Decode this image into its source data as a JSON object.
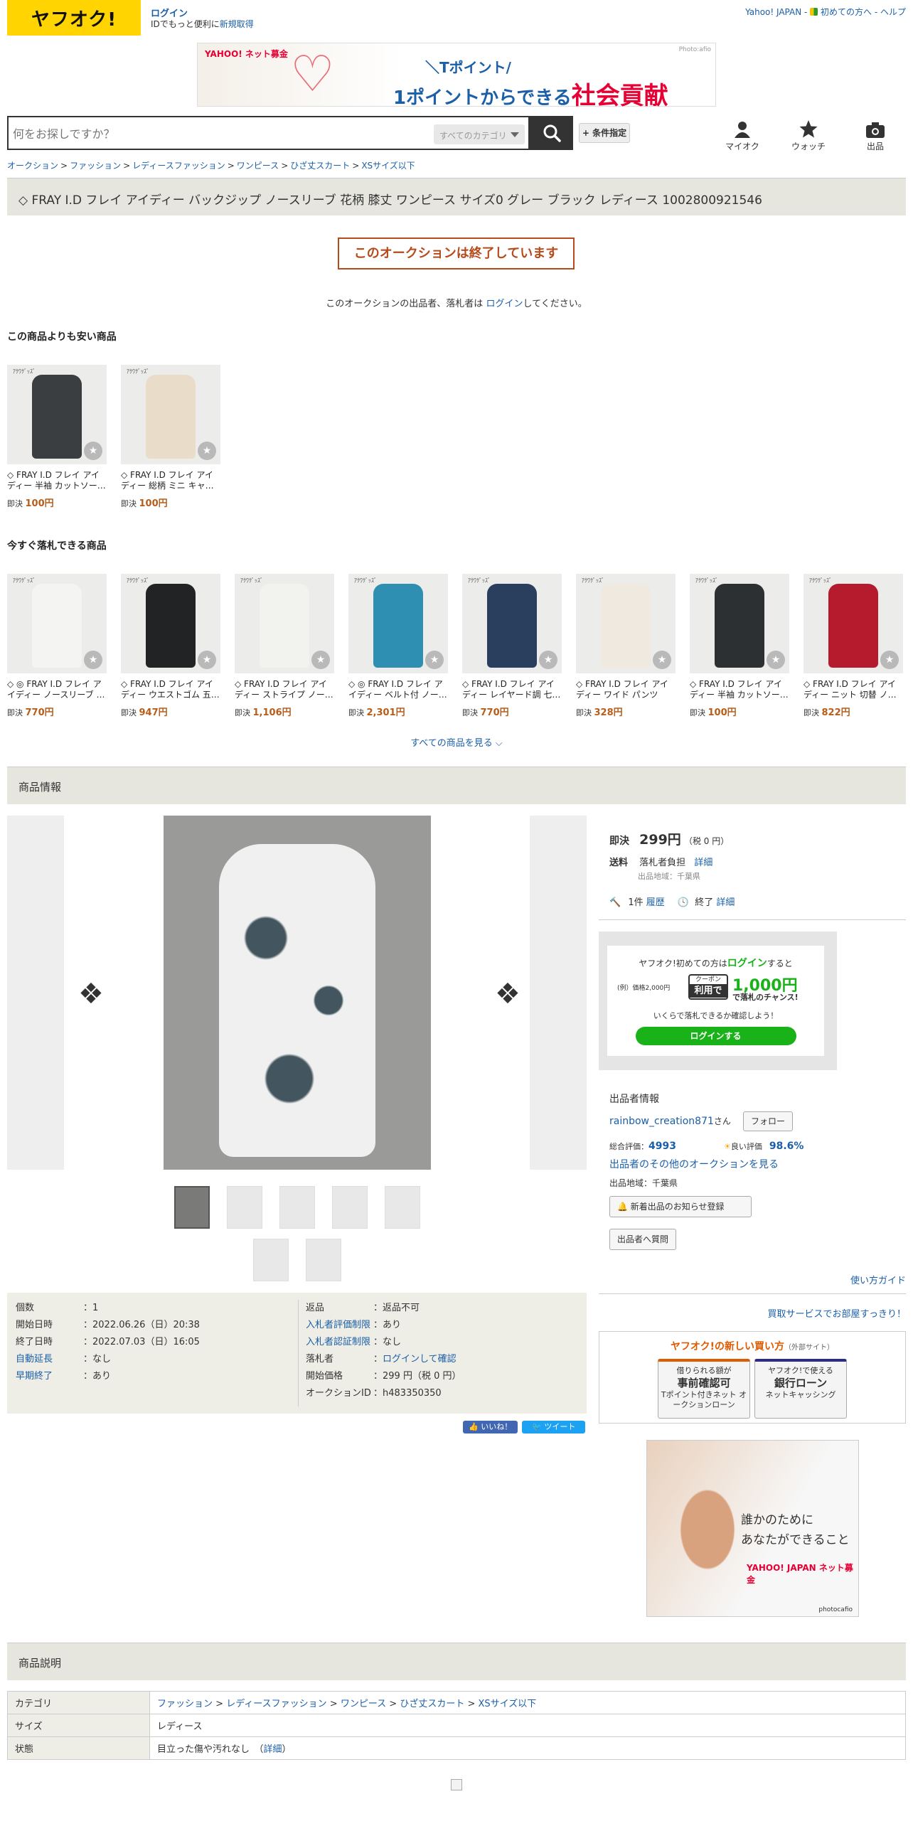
{
  "header": {
    "logo_text": "ヤフオク!",
    "login_label": "ログイン",
    "login_sub_prefix": "IDでもっと便利に",
    "login_sub_link": "新規取得",
    "top_links": [
      "Yahoo! JAPAN",
      "初めての方へ",
      "ヘルプ"
    ],
    "banner": {
      "brand": "YAHOO! ネット募金",
      "line1": "＼Tポイント/",
      "line2_a": "1ポイントからできる",
      "line2_b": "社会貢献",
      "credit": "Photo:afio"
    },
    "search": {
      "placeholder": "何をお探しですか？",
      "category": "すべてのカテゴリ",
      "condition_label": "+ 条件指定"
    },
    "icons": [
      {
        "label": "マイオク",
        "icon": "person-icon"
      },
      {
        "label": "ウォッチ",
        "icon": "star-icon"
      },
      {
        "label": "出品",
        "icon": "camera-icon"
      }
    ]
  },
  "breadcrumb": [
    "オークション",
    "ファッション",
    "レディースファッション",
    "ワンピース",
    "ひざ丈スカート",
    "XSサイズ以下"
  ],
  "title": "◇ FRAY I.D フレイ アイディー バックジップ ノースリーブ 花柄 膝丈 ワンピース サイズ0 グレー ブラック レディース 1002800921546",
  "ended": {
    "label": "このオークションは終了しています",
    "msg_prefix": "このオークションの出品者、落札者は",
    "msg_link": "ログイン",
    "msg_suffix": "してください。"
  },
  "cheaper": {
    "heading": "この商品よりも安い商品",
    "items": [
      {
        "name": "◇ FRAY I.D フレイ アイディー 半袖 カットソー…",
        "price_prefix": "即決",
        "price": "100円",
        "color": "#3a3e41"
      },
      {
        "name": "◇ FRAY I.D フレイ アイディー 総柄 ミニ キャ…",
        "price_prefix": "即決",
        "price": "100円",
        "color": "#e9dcc8"
      }
    ]
  },
  "instant": {
    "heading": "今すぐ落札できる商品",
    "items": [
      {
        "name": "◇ ◎ FRAY I.D フレイ アイディー ノースリーブ …",
        "price_prefix": "即決",
        "price": "770円",
        "color": "#f4f4f2"
      },
      {
        "name": "◇ FRAY I.D フレイ アイディー ウエストゴム 五…",
        "price_prefix": "即決",
        "price": "947円",
        "color": "#222324"
      },
      {
        "name": "◇ FRAY I.D フレイ アイディー ストライプ ノー…",
        "price_prefix": "即決",
        "price": "1,106円",
        "color": "#f2f2ef"
      },
      {
        "name": "◇ ◎ FRAY I.D フレイ アイディー ベルト付 ノー…",
        "price_prefix": "即決",
        "price": "2,301円",
        "color": "#2e8fb2"
      },
      {
        "name": "◇ FRAY I.D フレイ アイディー レイヤード調 七…",
        "price_prefix": "即決",
        "price": "770円",
        "color": "#2a3f5e"
      },
      {
        "name": "◇ FRAY I.D フレイ アイディー ワイド パンツ サ…",
        "price_prefix": "即決",
        "price": "328円",
        "color": "#efe9df"
      },
      {
        "name": "◇ FRAY I.D フレイ アイディー 半袖 カットソー…",
        "price_prefix": "即決",
        "price": "100円",
        "color": "#2c3033"
      },
      {
        "name": "◇ FRAY I.D フレイ アイディー ニット 切替 ノ…",
        "price_prefix": "即決",
        "price": "822円",
        "color": "#b51b2c"
      }
    ],
    "see_all": "すべての商品を見る"
  },
  "product_info": {
    "heading": "商品情報",
    "price_label": "即決",
    "price": "299円",
    "price_tax": "（税 0 円）",
    "shipping_label": "送料",
    "shipping_value": "落札者負担",
    "shipping_detail": "詳細",
    "location": "出品地域：千葉県",
    "bids": "1件",
    "bids_history": "履歴",
    "end_label": "終了",
    "end_detail": "詳細"
  },
  "promo": {
    "line1_a": "ヤフオク!初めての方は",
    "line1_b": "ログイン",
    "line1_c": "すると",
    "example": "(例）価格2,000円",
    "coupon_top": "クーポン",
    "coupon_bottom": "利用で",
    "amount": "1,000円",
    "chance": "で落札のチャンス!",
    "line3": "いくらで落札できるか確認しよう！",
    "button": "ログインする"
  },
  "seller": {
    "heading": "出品者情報",
    "name": "rainbow_creation871",
    "san": "さん",
    "follow": "フォロー",
    "rating_label": "総合評価：",
    "rating": "4993",
    "good_label": "良い評価",
    "good": "98.6%",
    "other_link": "出品者のその他のオークションを見る",
    "location": "出品地域：千葉県",
    "notify_btn": "新着出品のお知らせ登録",
    "question_btn": "出品者へ質問",
    "guide": "使い方ガイド",
    "kaitori": "買取サービスでお部屋すっきり！"
  },
  "new_buy": {
    "heading": "ヤフオク!の新しい買い方",
    "heading_sub": "（外部サイト）",
    "btn1_top": "借りられる額が",
    "btn1_main": "事前確認可",
    "btn1_sub": "Tポイント付きネット オークションローン",
    "btn2_top": "ヤフオク!で使える",
    "btn2_main": "銀行ローン",
    "btn2_sub": "ネットキャッシング"
  },
  "ad": {
    "line1": "誰かのために",
    "line2": "あなたができること",
    "brand": "YAHOO! JAPAN ネット募金",
    "credit": "photocafio"
  },
  "specs_left": [
    {
      "key": "個数",
      "value": "1",
      "link": false
    },
    {
      "key": "開始日時",
      "value": "2022.06.26（日）20:38",
      "link": false
    },
    {
      "key": "終了日時",
      "value": "2022.07.03（日）16:05",
      "link": false
    },
    {
      "key": "自動延長",
      "value": "なし",
      "link": true
    },
    {
      "key": "早期終了",
      "value": "あり",
      "link": true
    }
  ],
  "specs_right": [
    {
      "key": "返品",
      "value": "返品不可",
      "link": false,
      "vlink": false
    },
    {
      "key": "入札者評価制限",
      "value": "あり",
      "link": true,
      "vlink": false
    },
    {
      "key": "入札者認証制限",
      "value": "なし",
      "link": true,
      "vlink": false
    },
    {
      "key": "落札者",
      "value": "ログインして確認",
      "link": false,
      "vlink": true
    },
    {
      "key": "開始価格",
      "value": "299 円（税 0 円）",
      "link": false,
      "vlink": false
    },
    {
      "key": "オークションID",
      "value": "h483350350",
      "link": false,
      "vlink": false
    }
  ],
  "social": {
    "like": "いいね！",
    "tweet": "ツイート"
  },
  "description": {
    "heading": "商品説明",
    "category_label": "カテゴリ",
    "category_path": [
      "ファッション",
      "レディースファッション",
      "ワンピース",
      "ひざ丈スカート",
      "XSサイズ以下"
    ],
    "size_label": "サイズ",
    "size_value": "レディース",
    "condition_label": "状態",
    "condition_value": "目立った傷や汚れなし",
    "condition_detail": "詳細"
  },
  "colors": {
    "accent_orange": "#b54b1b",
    "brand_yellow": "#ffd400",
    "link_blue": "#1a5fa8",
    "price_orange": "#b75d1a",
    "green": "#19b219"
  }
}
